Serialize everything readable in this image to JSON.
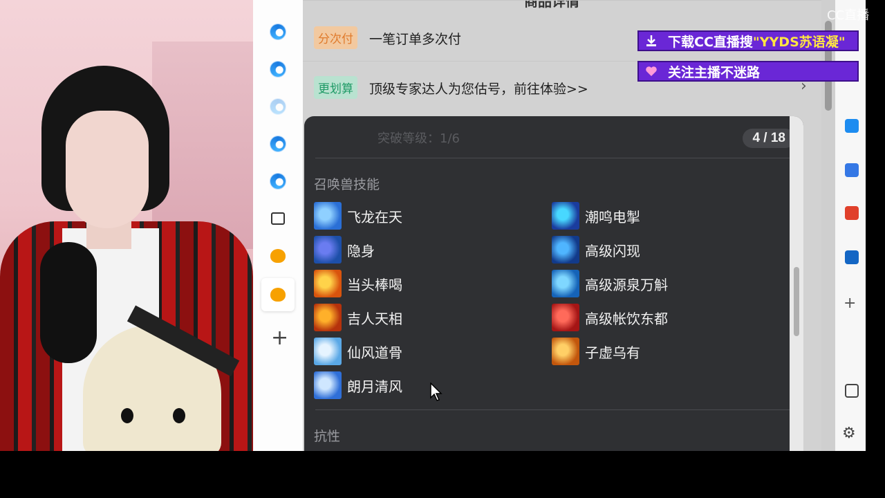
{
  "stream": {
    "watermark": "CC直播",
    "banner_download": {
      "text": "下载CC直播搜",
      "highlight": "\"YYDS苏语凝\""
    },
    "banner_follow": {
      "text": "关注主播不迷路"
    }
  },
  "page": {
    "title": "商品详情",
    "rows": [
      {
        "tag": "分次付",
        "text": "一笔订单多次付",
        "tag_color": "#f2c9a0",
        "tag_text_color": "#e07b2c"
      },
      {
        "tag": "更划算",
        "text": "顶级专家达人为您估号，前往体验>>",
        "tag_color": "#b9e2d0",
        "tag_text_color": "#1f9a66"
      }
    ]
  },
  "popover": {
    "pager": "4 / 18",
    "background_text": "突破等级：1/6",
    "section_pets": "召唤兽技能",
    "section_next": "抗性",
    "skills_left": [
      {
        "name": "飞龙在天",
        "icon": "dragon-skill-icon",
        "c1": "#2a6fd6",
        "c2": "#8fd0ff"
      },
      {
        "name": "隐身",
        "icon": "stealth-skill-icon",
        "c1": "#1d4fa8",
        "c2": "#6a7cf0"
      },
      {
        "name": "当头棒喝",
        "icon": "strike-skill-icon",
        "c1": "#d9540d",
        "c2": "#ffd34a"
      },
      {
        "name": "吉人天相",
        "icon": "fortune-skill-icon",
        "c1": "#b5320c",
        "c2": "#ffb02a"
      },
      {
        "name": "仙风道骨",
        "icon": "immortal-skill-icon",
        "c1": "#5aa8e6",
        "c2": "#e6f4ff"
      },
      {
        "name": "朗月清风",
        "icon": "moon-skill-icon",
        "c1": "#2f6fd8",
        "c2": "#cfe7ff"
      }
    ],
    "skills_right": [
      {
        "name": "潮鸣电掣",
        "icon": "thunder-skill-icon",
        "c1": "#1a3c9e",
        "c2": "#48d8ff"
      },
      {
        "name": "高级闪现",
        "icon": "flash-skill-icon",
        "c1": "#123a8a",
        "c2": "#4fb5ff"
      },
      {
        "name": "高级源泉万斛",
        "icon": "spring-skill-icon",
        "c1": "#1563b8",
        "c2": "#7fd7ff"
      },
      {
        "name": "高级帐饮东都",
        "icon": "banquet-skill-icon",
        "c1": "#a51515",
        "c2": "#ff6a5a"
      },
      {
        "name": "子虚乌有",
        "icon": "void-skill-icon",
        "c1": "#c2560c",
        "c2": "#ffcf66"
      }
    ]
  }
}
